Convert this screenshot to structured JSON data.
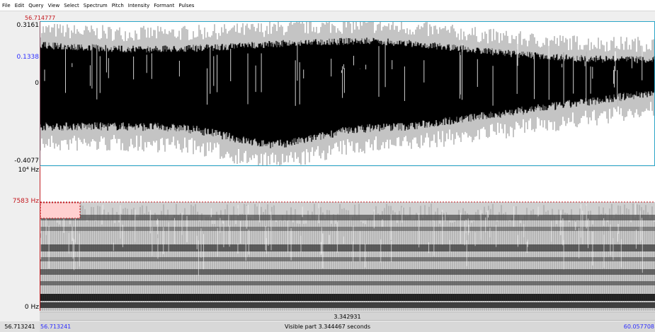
{
  "menu": [
    "File",
    "Edit",
    "Query",
    "View",
    "Select",
    "Spectrum",
    "Pitch",
    "Intensity",
    "Formant",
    "Pulses"
  ],
  "cursor_time": "56.714777",
  "waveform": {
    "y_max": "0.3161",
    "y_cursor": "0.1338",
    "y_zero": "0",
    "y_min": "-0.4077"
  },
  "spectrogram": {
    "f_max": "10⁴ Hz",
    "f_cursor": "7583 Hz",
    "f_min": "0 Hz"
  },
  "duration_label": "3.342931",
  "status": {
    "left_value": "56.713241",
    "selection_start": "56.713241",
    "visible_text": "Visible part 3.344467 seconds",
    "window_end": "60.057708"
  },
  "colors": {
    "waveform_border": "#2aa5c7",
    "cursor_red": "#c4161c",
    "cursor_blue": "#2b2bff"
  }
}
